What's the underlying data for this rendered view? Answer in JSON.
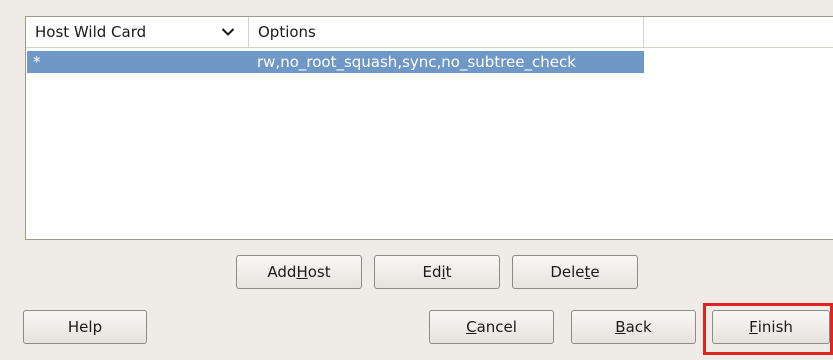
{
  "table": {
    "columns": [
      {
        "label": "Host Wild Card",
        "sort_icon": "chevron-down-icon"
      },
      {
        "label": "Options"
      }
    ],
    "rows": [
      {
        "host": "*",
        "options": "rw,no_root_squash,sync,no_subtree_check",
        "selected": true
      }
    ],
    "selection_color": "#6f98c7"
  },
  "buttons": {
    "add_host": {
      "pre": "Add ",
      "mnemonic": "H",
      "post": "ost"
    },
    "edit": {
      "pre": "Ed",
      "mnemonic": "i",
      "post": "t"
    },
    "delete": {
      "pre": "Dele",
      "mnemonic": "t",
      "post": "e"
    },
    "help": {
      "label": "Help"
    },
    "cancel": {
      "pre": "",
      "mnemonic": "C",
      "post": "ancel"
    },
    "back": {
      "pre": "",
      "mnemonic": "B",
      "post": "ack"
    },
    "finish": {
      "pre": "",
      "mnemonic": "F",
      "post": "inish"
    }
  },
  "highlight_color": "#e32222"
}
